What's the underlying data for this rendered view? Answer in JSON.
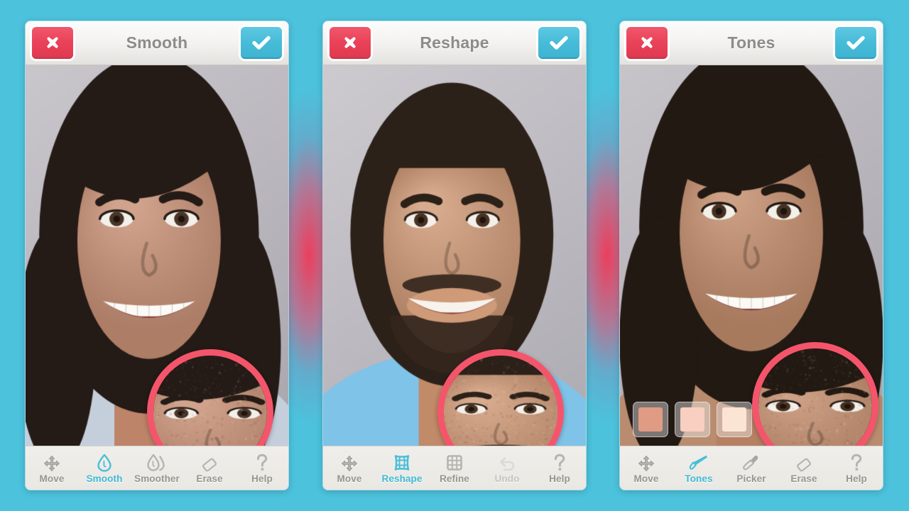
{
  "app": {
    "background_color": "#4cc2dc",
    "accent_color": "#3fb9d6",
    "cancel_color": "#ea4258",
    "loupe_ring_color": "#f4556b"
  },
  "panels": [
    {
      "id": "smooth",
      "header": {
        "title": "Smooth",
        "cancel_label": "✖",
        "cancel_icon": "close-x-icon",
        "confirm_label": "✔",
        "confirm_icon": "checkmark-icon"
      },
      "photo": {
        "subject": "woman-smiling-dark-hair",
        "background": "studio-gray"
      },
      "loupe": {
        "visible": true,
        "ring_color": "#f4556b"
      },
      "swatches": {
        "visible": false,
        "colors": []
      },
      "tools": [
        {
          "label": "Move",
          "icon": "move-arrows-icon",
          "state": "normal"
        },
        {
          "label": "Smooth",
          "icon": "water-droplet-icon",
          "state": "active"
        },
        {
          "label": "Smoother",
          "icon": "double-droplet-icon",
          "state": "normal"
        },
        {
          "label": "Erase",
          "icon": "eraser-icon",
          "state": "normal"
        },
        {
          "label": "Help",
          "icon": "question-mark-icon",
          "state": "normal"
        }
      ]
    },
    {
      "id": "reshape",
      "header": {
        "title": "Reshape",
        "cancel_label": "✖",
        "cancel_icon": "close-x-icon",
        "confirm_label": "✔",
        "confirm_icon": "checkmark-icon"
      },
      "photo": {
        "subject": "man-smiling-beard-blue-shirt",
        "background": "studio-gray"
      },
      "loupe": {
        "visible": true,
        "ring_color": "#f4556b"
      },
      "swatches": {
        "visible": false,
        "colors": []
      },
      "tools": [
        {
          "label": "Move",
          "icon": "move-arrows-icon",
          "state": "normal"
        },
        {
          "label": "Reshape",
          "icon": "warped-grid-icon",
          "state": "active"
        },
        {
          "label": "Refine",
          "icon": "square-grid-icon",
          "state": "normal"
        },
        {
          "label": "Undo",
          "icon": "undo-icon",
          "state": "disabled"
        },
        {
          "label": "Help",
          "icon": "question-mark-icon",
          "state": "normal"
        }
      ]
    },
    {
      "id": "tones",
      "header": {
        "title": "Tones",
        "cancel_label": "✖",
        "cancel_icon": "close-x-icon",
        "confirm_label": "✔",
        "confirm_icon": "checkmark-icon"
      },
      "photo": {
        "subject": "woman-smiling-dark-hair-sleeveless",
        "background": "studio-gray"
      },
      "loupe": {
        "visible": true,
        "ring_color": "#f4556b"
      },
      "swatches": {
        "visible": true,
        "colors": [
          "#e09b84",
          "#f8cfc0",
          "#fbe4d3"
        ]
      },
      "tools": [
        {
          "label": "Move",
          "icon": "move-arrows-icon",
          "state": "normal"
        },
        {
          "label": "Tones",
          "icon": "brush-pen-icon",
          "state": "active"
        },
        {
          "label": "Picker",
          "icon": "eyedropper-icon",
          "state": "normal"
        },
        {
          "label": "Erase",
          "icon": "eraser-icon",
          "state": "normal"
        },
        {
          "label": "Help",
          "icon": "question-mark-icon",
          "state": "normal"
        }
      ]
    }
  ]
}
